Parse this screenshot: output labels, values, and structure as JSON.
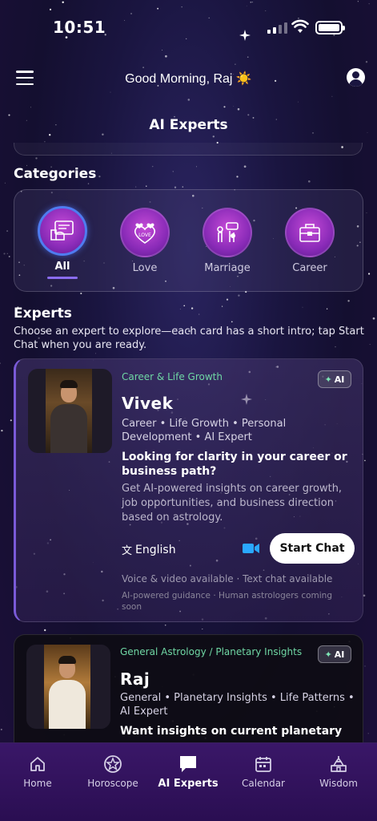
{
  "status_bar": {
    "time": "10:51"
  },
  "header": {
    "greeting": "Good Morning, Raj ☀️",
    "title": "AI Experts"
  },
  "categories": {
    "title": "Categories",
    "items": [
      {
        "label": "All",
        "icon": "all-icon",
        "active": true
      },
      {
        "label": "Love",
        "icon": "love-hearts-icon",
        "active": false
      },
      {
        "label": "Marriage",
        "icon": "marriage-hands-icon",
        "active": false
      },
      {
        "label": "Career",
        "icon": "briefcase-icon",
        "active": false
      }
    ]
  },
  "experts": {
    "title": "Experts",
    "subtitle": "Choose an expert to explore—each card has a short intro; tap Start Chat when you are ready.",
    "cards": [
      {
        "tag": "Career & Life Growth",
        "badge": "AI",
        "name": "Vivek",
        "specialties": "Career • Life Growth • Personal Development • AI Expert",
        "headline": "Looking for clarity in your career or business path?",
        "description": "Get AI-powered insights on career growth, job opportunities, and business direction based on astrology.",
        "language": "English",
        "cta": "Start Chat",
        "availability": "Voice & video available · Text chat available",
        "note": "AI-powered guidance · Human astrologers coming soon"
      },
      {
        "tag": "General Astrology / Planetary Insights",
        "badge": "AI",
        "name": "Raj",
        "specialties": "General • Planetary Insights • Life Patterns • AI Expert",
        "headline": "Want insights on current planetary"
      }
    ]
  },
  "bottom_nav": {
    "items": [
      {
        "label": "Home"
      },
      {
        "label": "Horoscope"
      },
      {
        "label": "AI Experts"
      },
      {
        "label": "Calendar"
      },
      {
        "label": "Wisdom"
      }
    ],
    "active_index": 2
  },
  "colors": {
    "accent_green": "#6fd6a4",
    "active_ring": "#4f7cf0",
    "video_blue": "#2aa8ff",
    "nav_bg": "#3a1768"
  }
}
